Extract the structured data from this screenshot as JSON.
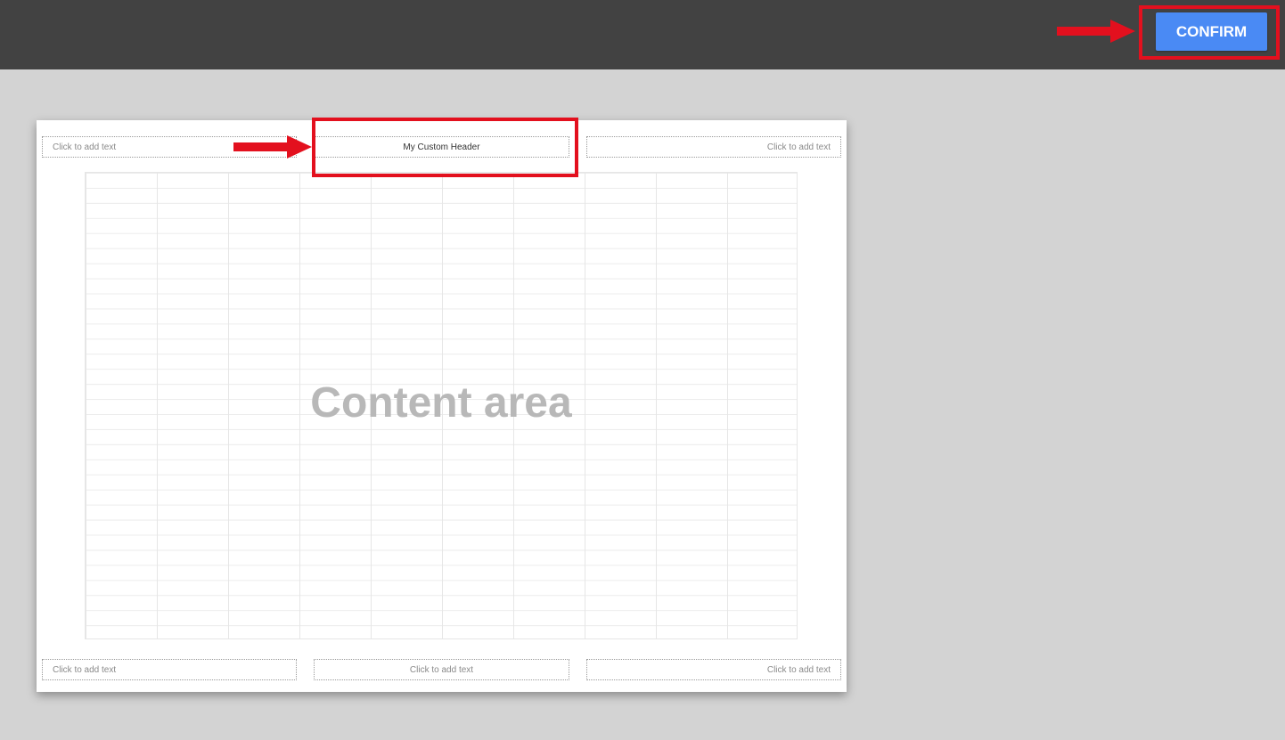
{
  "toolbar": {
    "confirm_label": "CONFIRM"
  },
  "header": {
    "left": "Click to add text",
    "center": "My Custom Header",
    "right": "Click to add text"
  },
  "footer": {
    "left": "Click to add text",
    "center": "Click to add text",
    "right": "Click to add text"
  },
  "content": {
    "label": "Content area"
  },
  "colors": {
    "topbar": "#424242",
    "background": "#d3d3d3",
    "confirm_button": "#4a8af4",
    "highlight": "#e3101e"
  },
  "annotations": {
    "arrow_icon": "right-arrow-icon"
  }
}
